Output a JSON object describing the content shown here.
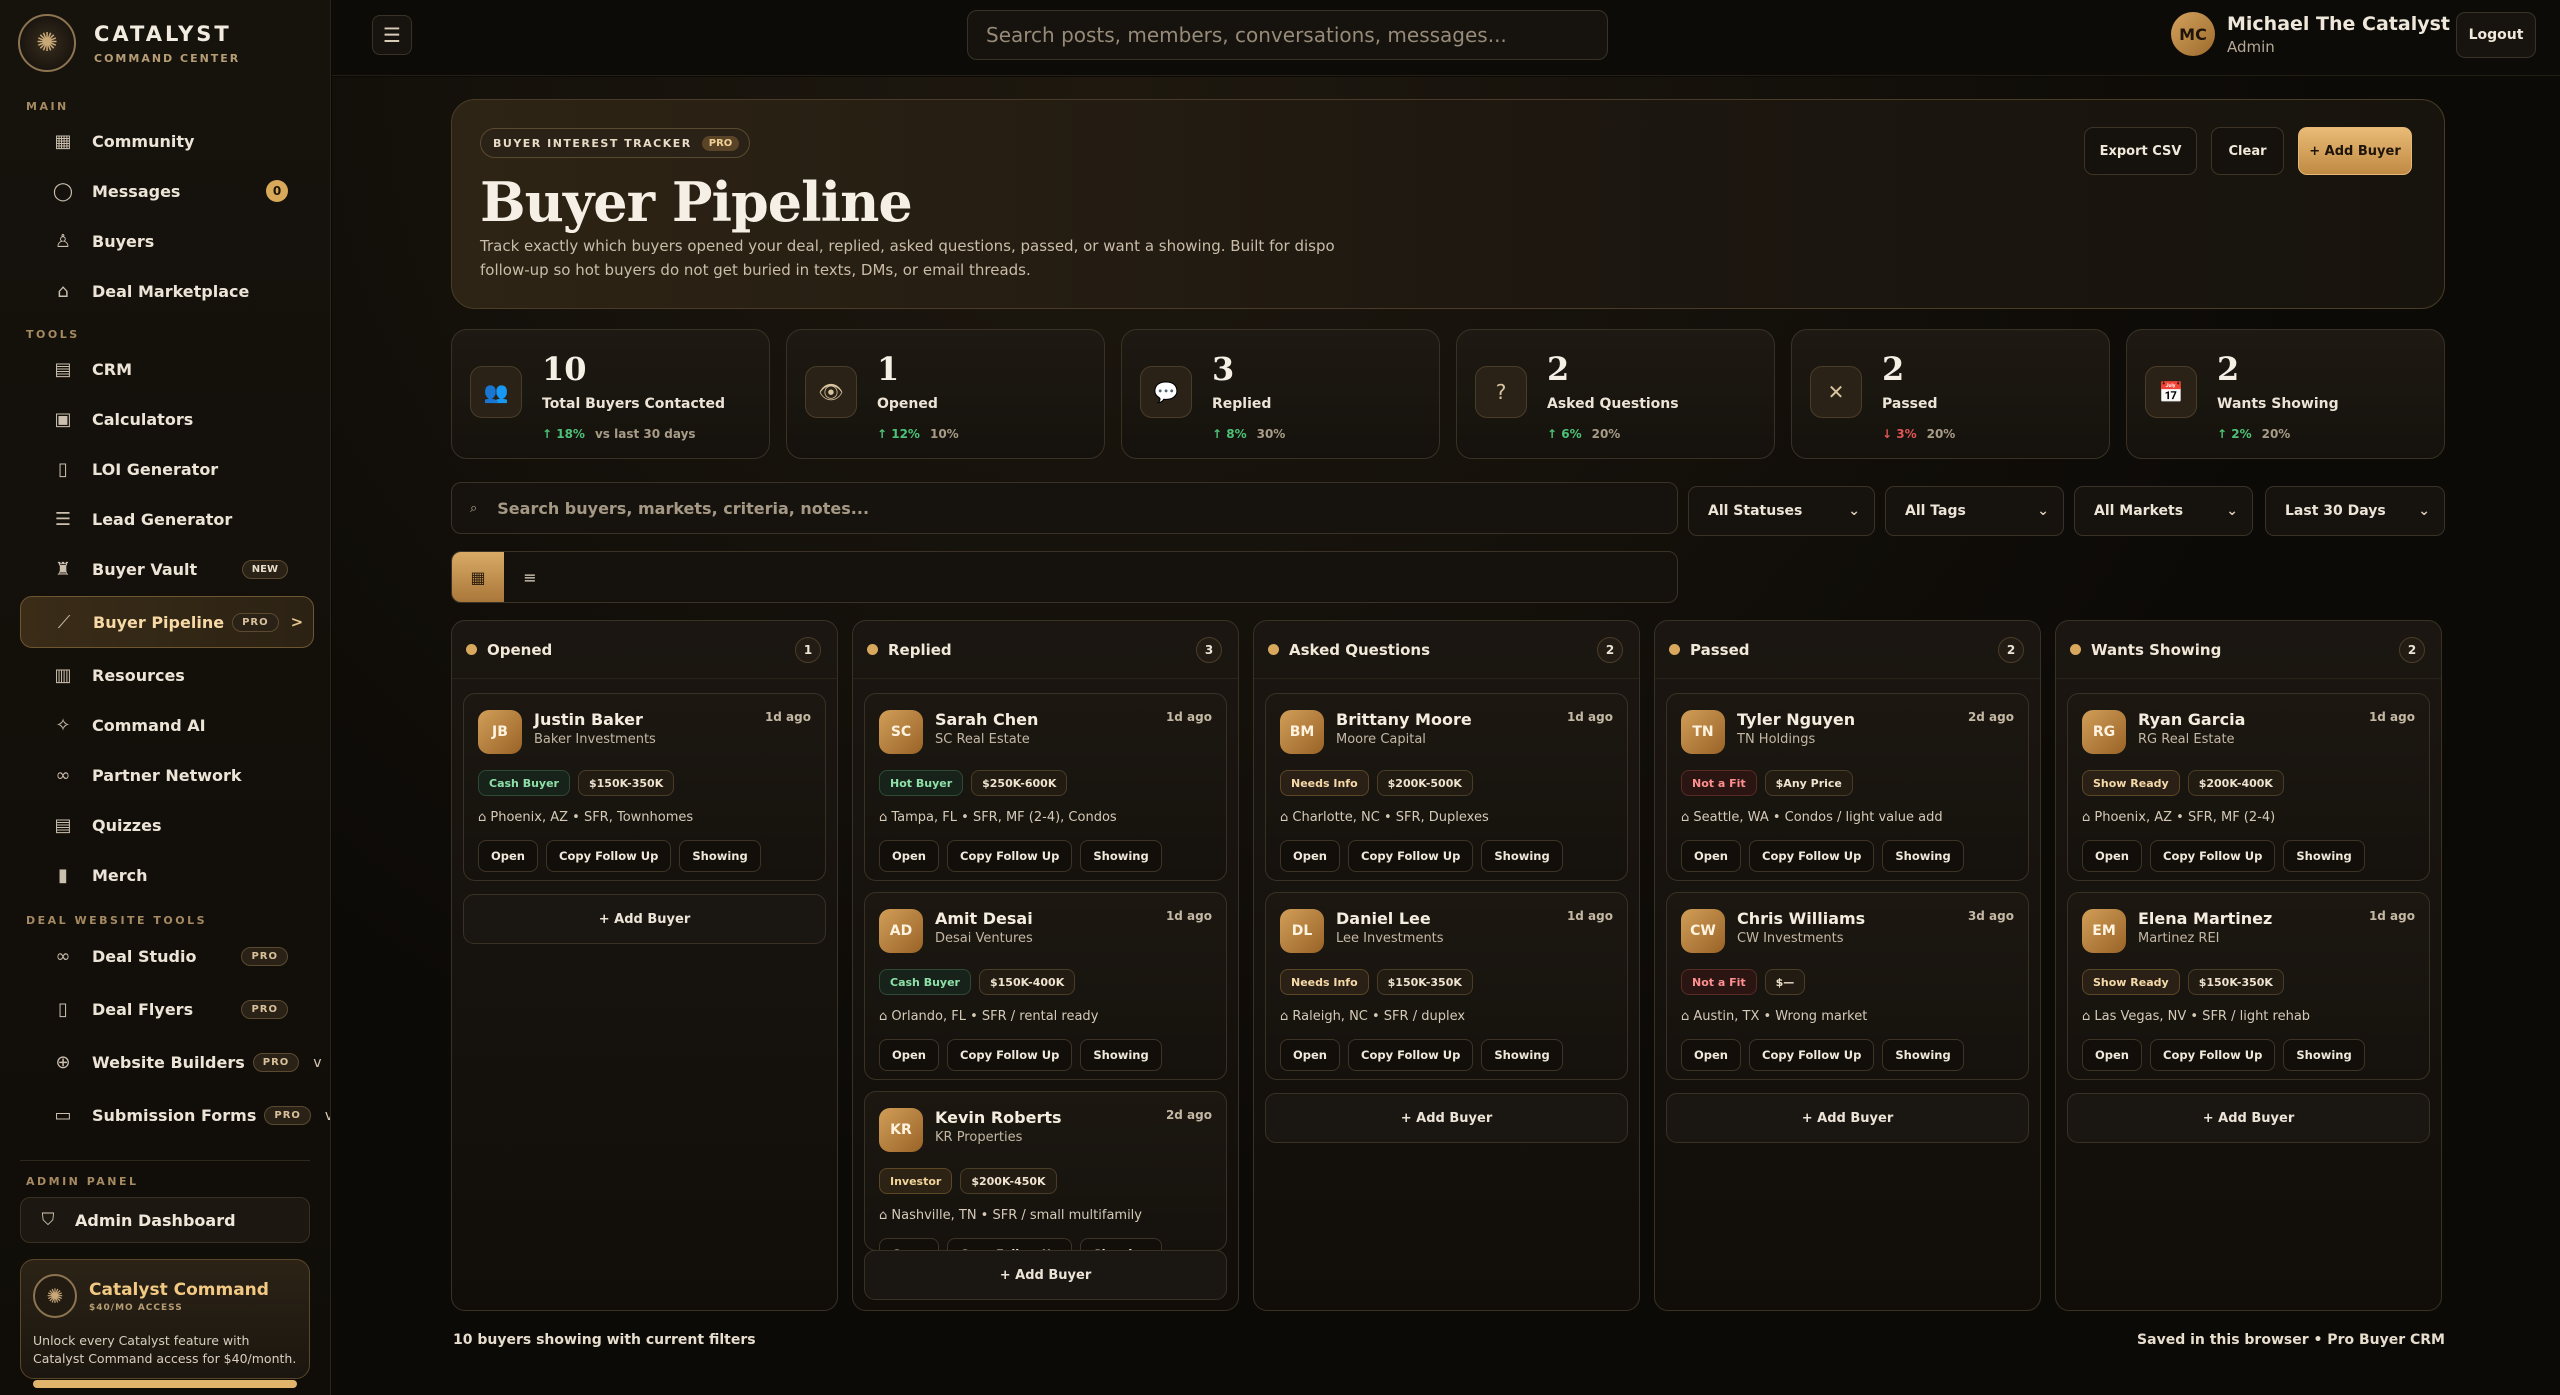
{
  "brand": {
    "name": "CATALYST",
    "sub": "COMMAND CENTER"
  },
  "sidebar": {
    "section_main": "MAIN",
    "section_tools": "TOOLS",
    "section_deal": "DEAL WEBSITE TOOLS",
    "section_admin": "ADMIN PANEL",
    "main_items": [
      {
        "label": "Community",
        "icon": "grid-icon"
      },
      {
        "label": "Messages",
        "icon": "chat-icon",
        "count": "0"
      },
      {
        "label": "Buyers",
        "icon": "user-icon"
      },
      {
        "label": "Deal Marketplace",
        "icon": "home-icon"
      }
    ],
    "tool_items": [
      {
        "label": "CRM",
        "icon": "table-icon"
      },
      {
        "label": "Calculators",
        "icon": "calculator-icon"
      },
      {
        "label": "LOI Generator",
        "icon": "document-icon"
      },
      {
        "label": "Lead Generator",
        "icon": "list-icon"
      },
      {
        "label": "Buyer Vault",
        "icon": "vault-icon",
        "badge": "NEW"
      },
      {
        "label": "Buyer Pipeline",
        "icon": "pipeline-icon",
        "badge": "PRO",
        "arrow": ">"
      },
      {
        "label": "Resources",
        "icon": "book-icon"
      },
      {
        "label": "Command AI",
        "icon": "ai-icon"
      },
      {
        "label": "Partner Network",
        "icon": "link-icon"
      },
      {
        "label": "Quizzes",
        "icon": "quiz-icon"
      },
      {
        "label": "Merch",
        "icon": "bag-icon"
      }
    ],
    "deal_items": [
      {
        "label": "Deal Studio",
        "icon": "link-icon",
        "badge": "PRO"
      },
      {
        "label": "Deal Flyers",
        "icon": "document-icon",
        "badge": "PRO"
      },
      {
        "label": "Website Builders",
        "icon": "globe-icon",
        "badge": "PRO",
        "chevron": "v"
      },
      {
        "label": "Submission Forms",
        "icon": "form-icon",
        "badge": "PRO",
        "chevron": "v"
      }
    ],
    "admin_dashboard": "Admin Dashboard",
    "promo": {
      "title": "Catalyst Command",
      "sub": "$40/MO ACCESS",
      "text": "Unlock every Catalyst feature with Catalyst Command access for $40/month."
    }
  },
  "topbar": {
    "search_placeholder": "Search posts, members, conversations, messages...",
    "user_initials": "MC",
    "user_name": "Michael The Catalyst",
    "user_role": "Admin",
    "logout": "Logout"
  },
  "hero": {
    "eyebrow": "BUYER INTEREST TRACKER",
    "eyebrow_badge": "PRO",
    "title": "Buyer Pipeline",
    "description": "Track exactly which buyers opened your deal, replied, asked questions, passed, or want a showing. Built for dispo follow-up so hot buyers do not get buried in texts, DMs, or email threads.",
    "export_csv": "Export CSV",
    "clear": "Clear",
    "add_buyer": "+ Add Buyer"
  },
  "stats": [
    {
      "value": "10",
      "label": "Total Buyers Contacted",
      "trend": "↑ 18%",
      "dir": "up",
      "note": "vs last 30 days",
      "icon": "👥"
    },
    {
      "value": "1",
      "label": "Opened",
      "trend": "↑ 12%",
      "dir": "up",
      "note": "10%",
      "icon": "👁"
    },
    {
      "value": "3",
      "label": "Replied",
      "trend": "↑ 8%",
      "dir": "up",
      "note": "30%",
      "icon": "💬"
    },
    {
      "value": "2",
      "label": "Asked Questions",
      "trend": "↑ 6%",
      "dir": "up",
      "note": "20%",
      "icon": "?"
    },
    {
      "value": "2",
      "label": "Passed",
      "trend": "↓ 3%",
      "dir": "down",
      "note": "20%",
      "icon": "✕"
    },
    {
      "value": "2",
      "label": "Wants Showing",
      "trend": "↑ 2%",
      "dir": "up",
      "note": "20%",
      "icon": "📅"
    }
  ],
  "filters": {
    "search_placeholder": "Search buyers, markets, criteria, notes...",
    "status": "All Statuses",
    "tags": "All Tags",
    "markets": "All Markets",
    "range": "Last 30 Days"
  },
  "card_actions": {
    "open": "Open",
    "copy": "Copy Follow Up",
    "showing": "Showing"
  },
  "add_buyer_label": "+ Add Buyer",
  "columns": [
    {
      "title": "Opened",
      "count": "1",
      "cards": [
        {
          "initials": "JB",
          "name": "Justin Baker",
          "company": "Baker Investments",
          "ago": "1d ago",
          "tag1": "Cash Buyer",
          "tag1_style": "g",
          "tag2": "$150K-350K",
          "loc": "⌂ Phoenix, AZ • SFR, Townhomes"
        }
      ]
    },
    {
      "title": "Replied",
      "count": "3",
      "cards": [
        {
          "initials": "SC",
          "name": "Sarah Chen",
          "company": "SC Real Estate",
          "ago": "1d ago",
          "tag1": "Hot Buyer",
          "tag1_style": "g",
          "tag2": "$250K-600K",
          "loc": "⌂ Tampa, FL • SFR, MF (2-4), Condos"
        },
        {
          "initials": "AD",
          "name": "Amit Desai",
          "company": "Desai Ventures",
          "ago": "1d ago",
          "tag1": "Cash Buyer",
          "tag1_style": "g",
          "tag2": "$150K-400K",
          "loc": "⌂ Orlando, FL • SFR / rental ready"
        },
        {
          "initials": "KR",
          "name": "Kevin Roberts",
          "company": "KR Properties",
          "ago": "2d ago",
          "tag1": "Investor",
          "tag1_style": "a",
          "tag2": "$200K-450K",
          "loc": "⌂ Nashville, TN • SFR / small multifamily"
        }
      ]
    },
    {
      "title": "Asked Questions",
      "count": "2",
      "cards": [
        {
          "initials": "BM",
          "name": "Brittany Moore",
          "company": "Moore Capital",
          "ago": "1d ago",
          "tag1": "Needs Info",
          "tag1_style": "n",
          "tag2": "$200K-500K",
          "loc": "⌂ Charlotte, NC • SFR, Duplexes"
        },
        {
          "initials": "DL",
          "name": "Daniel Lee",
          "company": "Lee Investments",
          "ago": "1d ago",
          "tag1": "Needs Info",
          "tag1_style": "n",
          "tag2": "$150K-350K",
          "loc": "⌂ Raleigh, NC • SFR / duplex"
        }
      ]
    },
    {
      "title": "Passed",
      "count": "2",
      "cards": [
        {
          "initials": "TN",
          "name": "Tyler Nguyen",
          "company": "TN Holdings",
          "ago": "2d ago",
          "tag1": "Not a Fit",
          "tag1_style": "r",
          "tag2": "$Any Price",
          "loc": "⌂ Seattle, WA • Condos / light value add"
        },
        {
          "initials": "CW",
          "name": "Chris Williams",
          "company": "CW Investments",
          "ago": "3d ago",
          "tag1": "Not a Fit",
          "tag1_style": "r",
          "tag2": "$—",
          "loc": "⌂ Austin, TX • Wrong market"
        }
      ]
    },
    {
      "title": "Wants Showing",
      "count": "2",
      "cards": [
        {
          "initials": "RG",
          "name": "Ryan Garcia",
          "company": "RG Real Estate",
          "ago": "1d ago",
          "tag1": "Show Ready",
          "tag1_style": "n",
          "tag2": "$200K-400K",
          "loc": "⌂ Phoenix, AZ • SFR, MF (2-4)"
        },
        {
          "initials": "EM",
          "name": "Elena Martinez",
          "company": "Martinez REI",
          "ago": "1d ago",
          "tag1": "Show Ready",
          "tag1_style": "n",
          "tag2": "$150K-350K",
          "loc": "⌂ Las Vegas, NV • SFR / light rehab"
        }
      ]
    }
  ],
  "footer": {
    "left": "10 buyers showing with current filters",
    "right": "Saved in this browser • Pro Buyer CRM"
  }
}
